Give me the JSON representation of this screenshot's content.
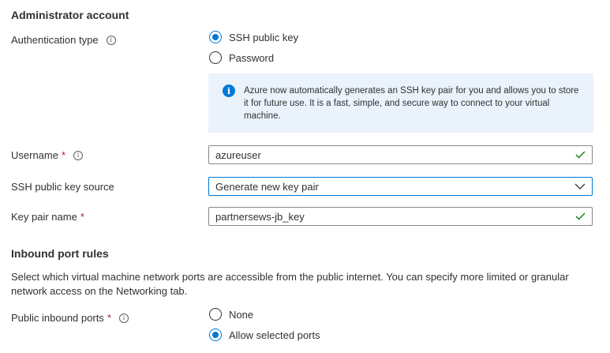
{
  "admin": {
    "section_title": "Administrator account",
    "auth_type_label": "Authentication type",
    "auth_options": [
      "SSH public key",
      "Password"
    ],
    "auth_selected": "SSH public key",
    "info_message": "Azure now automatically generates an SSH key pair for you and allows you to store it for future use. It is a fast, simple, and secure way to connect to your virtual machine.",
    "username_label": "Username",
    "username_value": "azureuser",
    "key_source_label": "SSH public key source",
    "key_source_value": "Generate new key pair",
    "key_pair_label": "Key pair name",
    "key_pair_value": "partnersews-jb_key",
    "required_marker": "*"
  },
  "inbound": {
    "section_title": "Inbound port rules",
    "description": "Select which virtual machine network ports are accessible from the public internet. You can specify more limited or granular network access on the Networking tab.",
    "public_ports_label": "Public inbound ports",
    "options": [
      "None",
      "Allow selected ports"
    ],
    "selected": "Allow selected ports"
  },
  "colors": {
    "accent": "#0078d4",
    "required": "#a4262c",
    "valid_check": "#107c10",
    "info_background": "#eaf3fc"
  }
}
